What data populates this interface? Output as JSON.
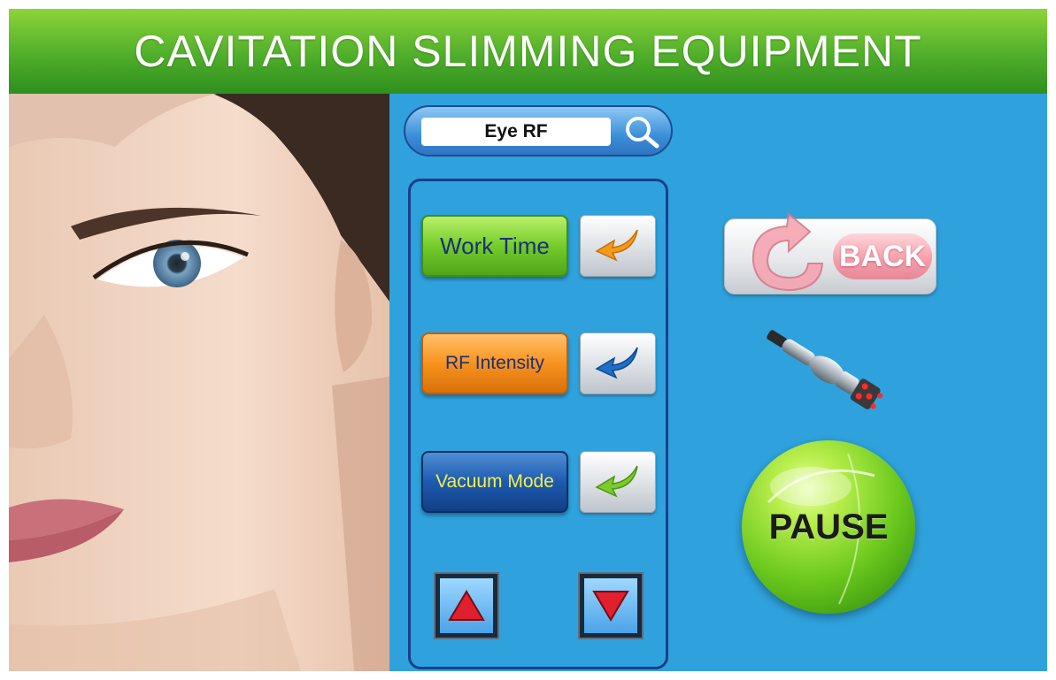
{
  "header": {
    "title": "CAVITATION SLIMMING EQUIPMENT"
  },
  "search": {
    "value": "Eye RF",
    "icon": "search-icon"
  },
  "modes": [
    {
      "label": "Work Time",
      "color": "#74cc2a",
      "arrow_color": "#f39a1c"
    },
    {
      "label": "RF Intensity",
      "color": "#f7931e",
      "arrow_color": "#1d6fc9"
    },
    {
      "label": "Vacuum Mode",
      "color": "#1d5ab0",
      "arrow_color": "#7acb2b"
    }
  ],
  "adjust": {
    "up_icon": "triangle-up-icon",
    "down_icon": "triangle-down-icon"
  },
  "back": {
    "label": "BACK",
    "icon": "back-arrow-icon"
  },
  "pause": {
    "label": "PAUSE"
  },
  "colors": {
    "background": "#2fa2dd",
    "header": "#4fae2a",
    "panel_border": "#1a3f8c"
  }
}
